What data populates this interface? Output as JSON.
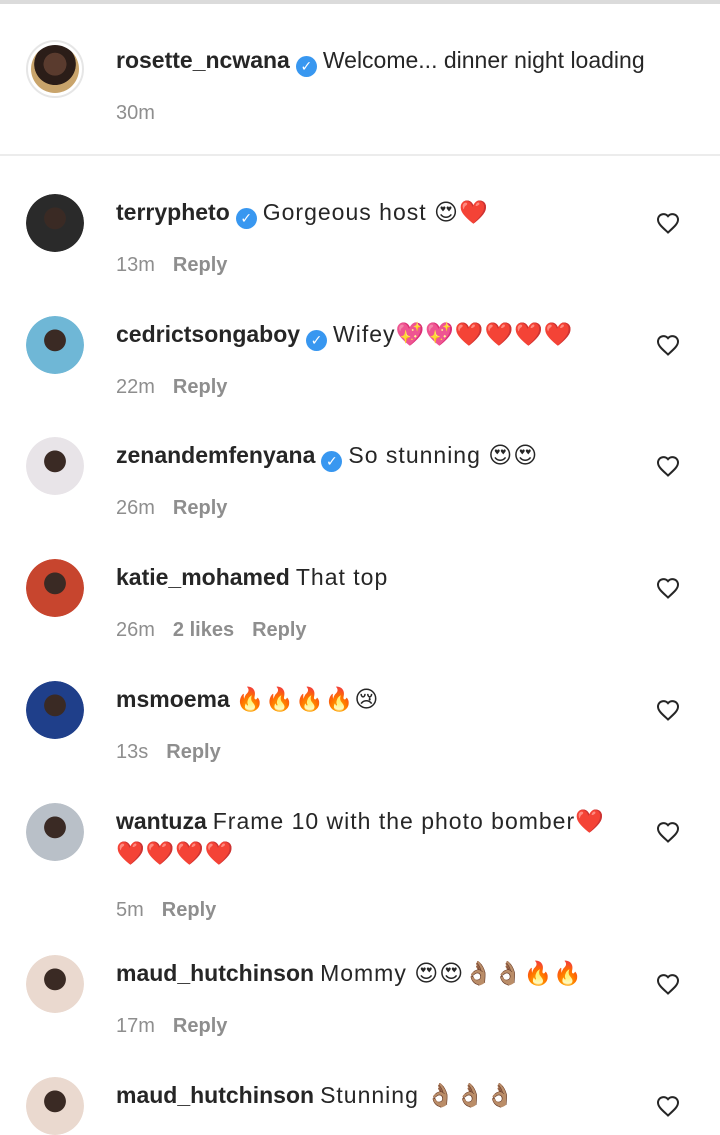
{
  "caption": {
    "username": "rosette_ncwana",
    "text": "Welcome... dinner night loading",
    "time": "30m",
    "verified": true
  },
  "reply_label": "Reply",
  "comments": [
    {
      "username": "terrypheto",
      "verified": true,
      "text": "Gorgeous host 😍❤️",
      "time": "13m",
      "likes": "",
      "avatar_color": "#2a2a2a"
    },
    {
      "username": "cedrictsongaboy",
      "verified": true,
      "text": "Wifey💖💖❤️❤️❤️❤️",
      "time": "22m",
      "likes": "",
      "avatar_color": "#6fb7d6"
    },
    {
      "username": "zenandemfenyana",
      "verified": true,
      "text": "So stunning 😍😍",
      "time": "26m",
      "likes": "",
      "avatar_color": "#e8e4e8"
    },
    {
      "username": "katie_mohamed",
      "verified": false,
      "text": "That top",
      "time": "26m",
      "likes": "2 likes",
      "avatar_color": "#c7452e"
    },
    {
      "username": "msmoema",
      "verified": false,
      "text": "🔥🔥🔥🔥😢",
      "time": "13s",
      "likes": "",
      "avatar_color": "#1f3f8a"
    },
    {
      "username": "wantuza",
      "verified": false,
      "text": "Frame 10 with the photo bomber❤️❤️❤️❤️❤️",
      "time": "5m",
      "likes": "",
      "avatar_color": "#b9c0c8"
    },
    {
      "username": "maud_hutchinson",
      "verified": false,
      "text": "Mommy 😍😍👌🏽👌🏽🔥🔥",
      "time": "17m",
      "likes": "",
      "avatar_color": "#ead9cf"
    },
    {
      "username": "maud_hutchinson",
      "verified": false,
      "text": "Stunning 👌🏽👌🏽👌🏽",
      "time": "",
      "likes": "",
      "avatar_color": "#ead9cf"
    }
  ],
  "icons": {
    "verified": "verified-badge-icon",
    "like": "heart-outline-icon"
  }
}
